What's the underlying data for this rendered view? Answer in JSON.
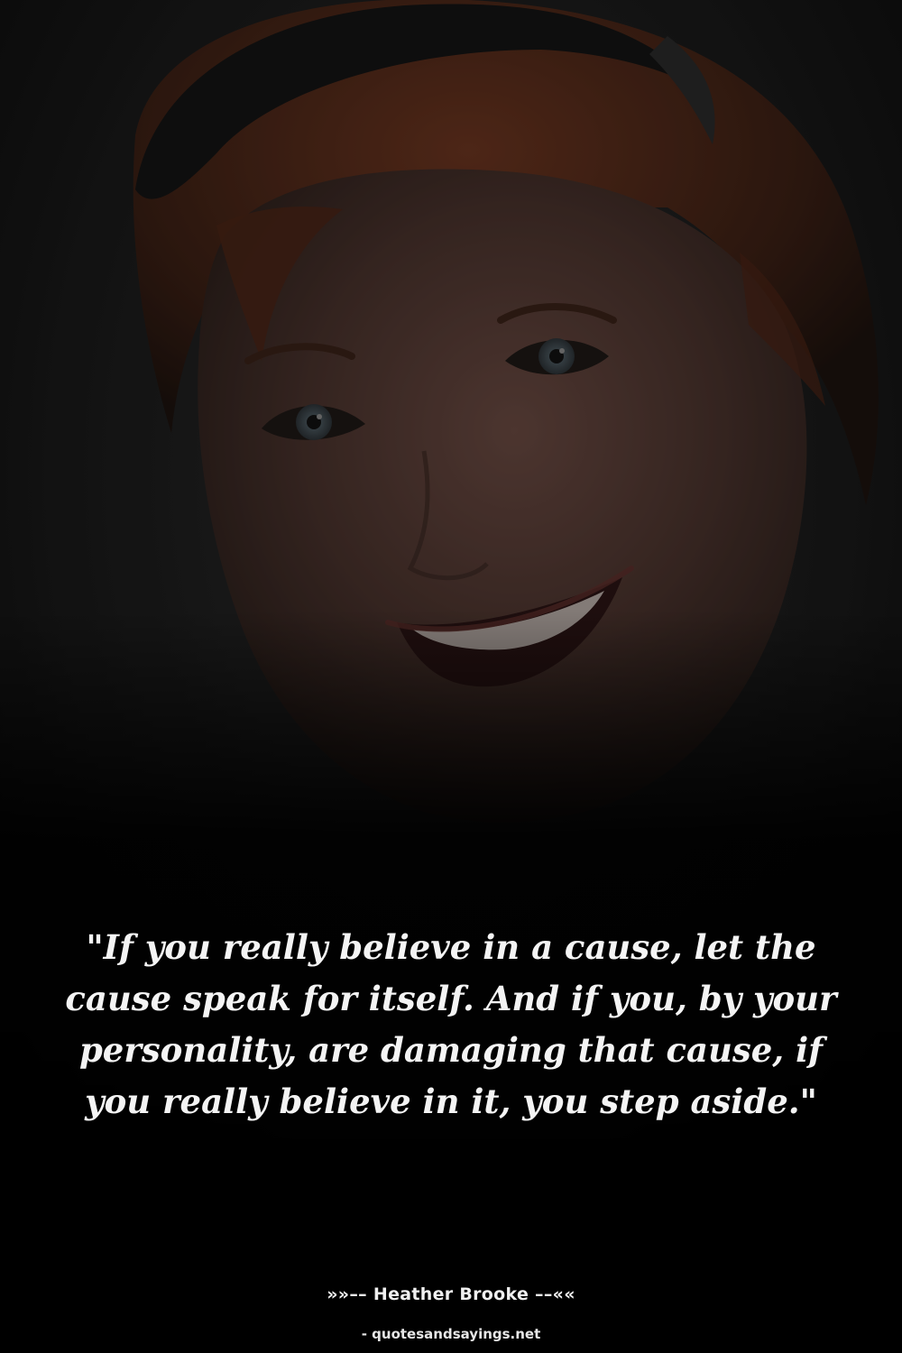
{
  "quote": {
    "text": "\"If you really believe in a cause, let the cause speak for itself. And if you, by your personality, are damaging that cause, if you really believe in it, you step aside.\""
  },
  "attribution": {
    "text": "»»–– Heather Brooke ––««"
  },
  "source": {
    "text": "- quotesandsayings.net"
  },
  "colors": {
    "background": "#000000",
    "text": "#f4f4f4",
    "hair": "#5a2f1c",
    "skin": "#5c4038"
  }
}
